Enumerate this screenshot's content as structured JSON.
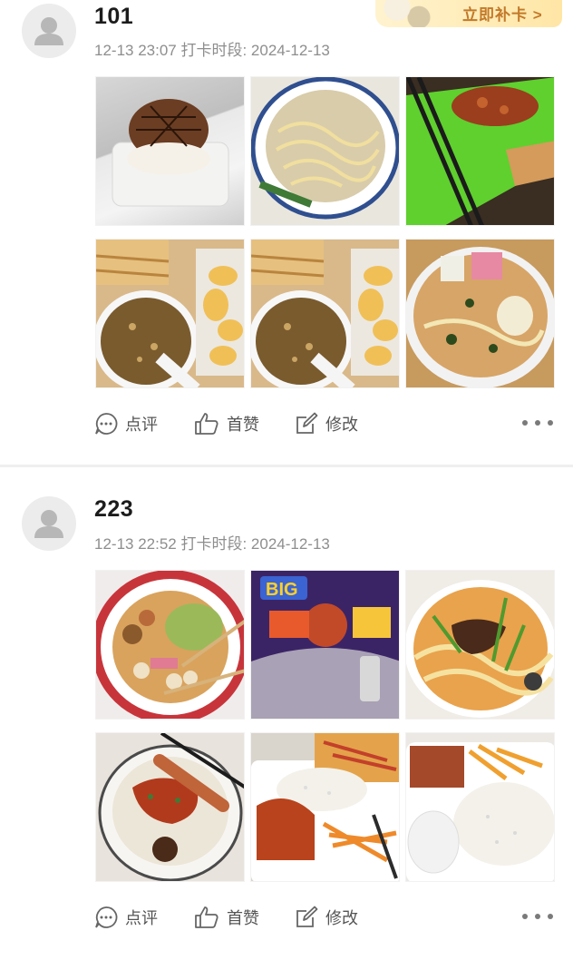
{
  "promo_badge": {
    "label": "立即补卡 >"
  },
  "posts": [
    {
      "username": "101",
      "meta": "12-13 23:07 打卡时段: 2024-12-13",
      "photos": [
        {
          "name": "cake-photo",
          "caption": ""
        },
        {
          "name": "noodle-soup-photo",
          "caption": ""
        },
        {
          "name": "fried-chicken-photo",
          "caption": ""
        },
        {
          "name": "porridge-bread-photo-1",
          "caption": ""
        },
        {
          "name": "porridge-bread-photo-2",
          "caption": ""
        },
        {
          "name": "spicy-hotpot-photo",
          "caption": ""
        }
      ],
      "actions": {
        "comment": "点评",
        "like": "首赞",
        "edit": "修改"
      }
    },
    {
      "username": "223",
      "meta": "12-13 22:52 打卡时段: 2024-12-13",
      "photos": [
        {
          "name": "malatang-bowl-photo",
          "caption": ""
        },
        {
          "name": "instant-noodle-cup-photo",
          "caption": "BIG 大食桶"
        },
        {
          "name": "beef-noodle-photo",
          "caption": ""
        },
        {
          "name": "spicy-wonton-photo",
          "caption": ""
        },
        {
          "name": "rice-plate-photo",
          "caption": ""
        },
        {
          "name": "rice-box-photo",
          "caption": ""
        }
      ],
      "actions": {
        "comment": "点评",
        "like": "首赞",
        "edit": "修改"
      }
    }
  ],
  "colors": {
    "meta_gray": "#8e8e8e",
    "badge_text": "#c2792a",
    "divider": "#efefef"
  }
}
